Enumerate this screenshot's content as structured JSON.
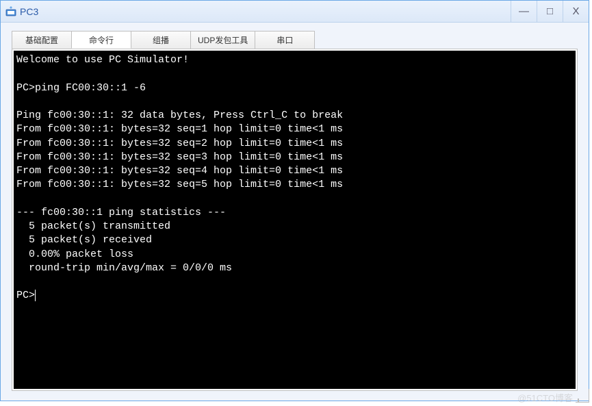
{
  "window": {
    "title": "PC3",
    "controls": {
      "minimize": "—",
      "maximize": "□",
      "close": "X"
    }
  },
  "tabs": [
    {
      "label": "基础配置",
      "active": false
    },
    {
      "label": "命令行",
      "active": true
    },
    {
      "label": "组播",
      "active": false
    },
    {
      "label": "UDP发包工具",
      "active": false
    },
    {
      "label": "串口",
      "active": false
    }
  ],
  "terminal": {
    "lines": [
      "Welcome to use PC Simulator!",
      "",
      "PC>ping FC00:30::1 -6",
      "",
      "Ping fc00:30::1: 32 data bytes, Press Ctrl_C to break",
      "From fc00:30::1: bytes=32 seq=1 hop limit=0 time<1 ms",
      "From fc00:30::1: bytes=32 seq=2 hop limit=0 time<1 ms",
      "From fc00:30::1: bytes=32 seq=3 hop limit=0 time<1 ms",
      "From fc00:30::1: bytes=32 seq=4 hop limit=0 time<1 ms",
      "From fc00:30::1: bytes=32 seq=5 hop limit=0 time<1 ms",
      "",
      "--- fc00:30::1 ping statistics ---",
      "  5 packet(s) transmitted",
      "  5 packet(s) received",
      "  0.00% packet loss",
      "  round-trip min/avg/max = 0/0/0 ms",
      "",
      "PC>"
    ]
  },
  "watermark": "@51CTO博客"
}
